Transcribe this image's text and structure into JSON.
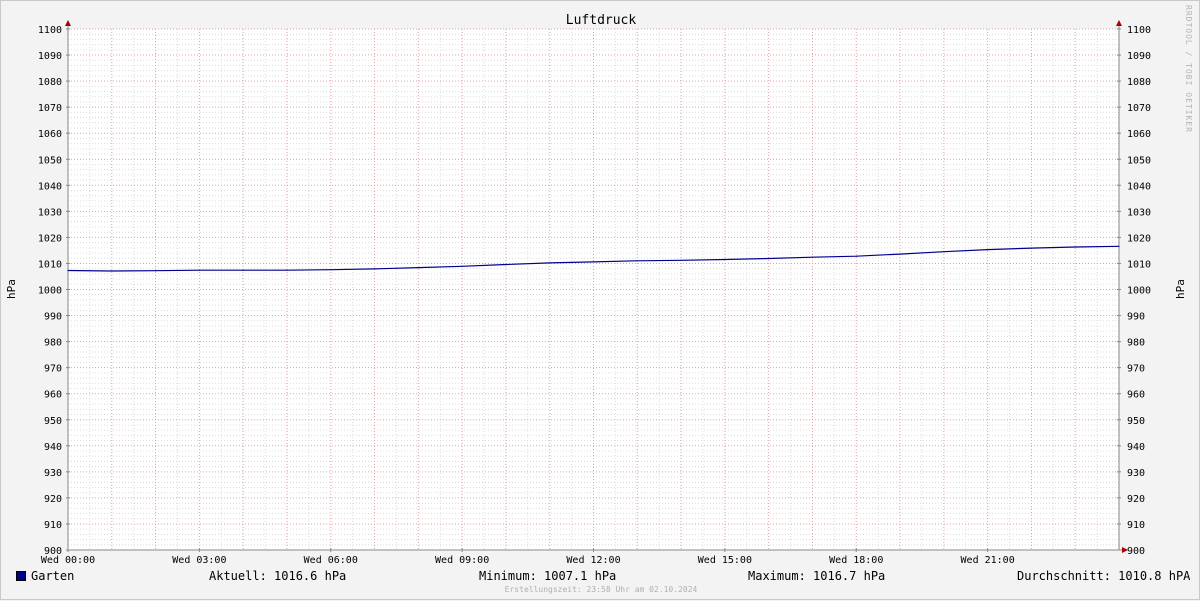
{
  "watermark": "RRDTOOL / TOBI OETIKER",
  "chart_data": {
    "type": "line",
    "title": "Luftdruck",
    "ylabel": "hPa",
    "ylabel_right": "hPa",
    "ylim": [
      900,
      1100
    ],
    "yticks": [
      900,
      910,
      920,
      930,
      940,
      950,
      960,
      970,
      980,
      990,
      1000,
      1010,
      1020,
      1030,
      1040,
      1050,
      1060,
      1070,
      1080,
      1090,
      1100
    ],
    "xlim": [
      0,
      24
    ],
    "xticks": [
      {
        "t": 0,
        "label": "Wed 00:00"
      },
      {
        "t": 3,
        "label": "Wed 03:00"
      },
      {
        "t": 6,
        "label": "Wed 06:00"
      },
      {
        "t": 9,
        "label": "Wed 09:00"
      },
      {
        "t": 12,
        "label": "Wed 12:00"
      },
      {
        "t": 15,
        "label": "Wed 15:00"
      },
      {
        "t": 18,
        "label": "Wed 18:00"
      },
      {
        "t": 21,
        "label": "Wed 21:00"
      }
    ],
    "grid": true,
    "series": [
      {
        "name": "Garten",
        "color": "#00008f",
        "x": [
          0,
          1,
          2,
          3,
          4,
          5,
          6,
          7,
          8,
          9,
          10,
          11,
          12,
          13,
          14,
          15,
          16,
          17,
          18,
          19,
          20,
          21,
          22,
          23,
          24
        ],
        "y": [
          1007.3,
          1007.1,
          1007.2,
          1007.4,
          1007.4,
          1007.4,
          1007.6,
          1007.9,
          1008.4,
          1008.9,
          1009.6,
          1010.2,
          1010.6,
          1011.0,
          1011.2,
          1011.5,
          1011.9,
          1012.4,
          1012.8,
          1013.6,
          1014.5,
          1015.3,
          1015.9,
          1016.3,
          1016.6
        ]
      }
    ],
    "legend": {
      "name": "Garten",
      "current": "Aktuell: 1016.6 hPa",
      "minimum": "Minimum: 1007.1 hPa",
      "maximum": "Maximum: 1016.7 hPa",
      "average": "Durchschnitt: 1010.8 hPA"
    },
    "footer": "Erstellungszeit: 23:58 Uhr am 02.10.2024"
  }
}
